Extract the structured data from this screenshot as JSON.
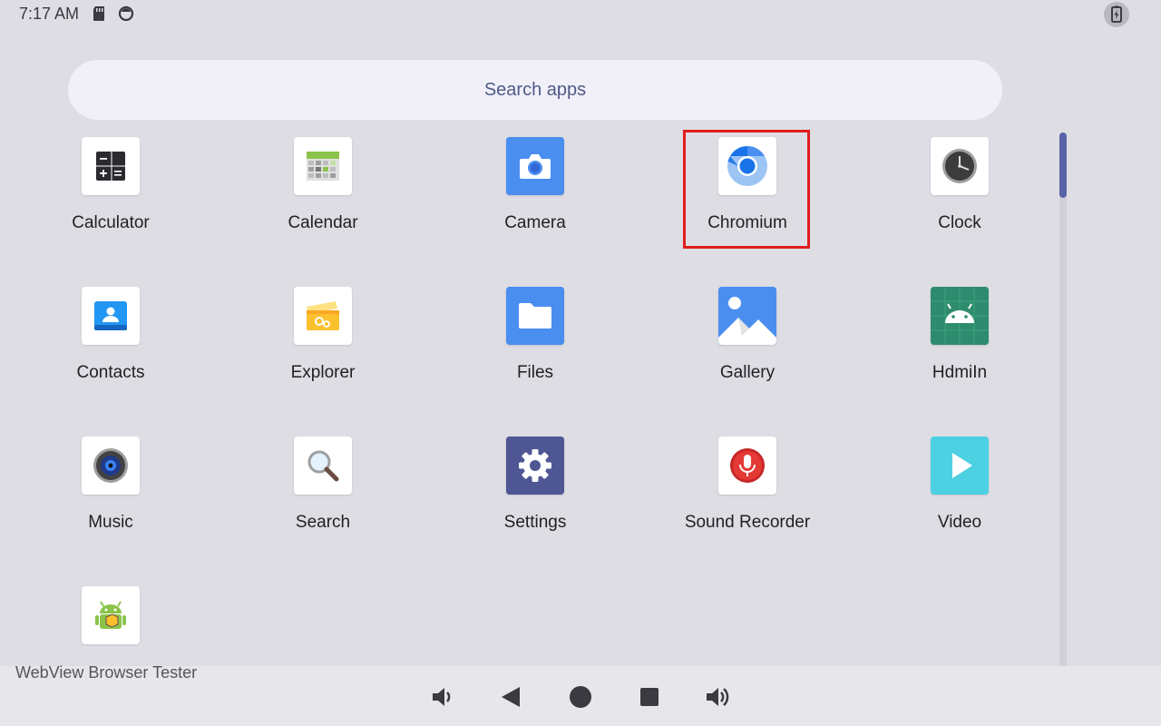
{
  "status_bar": {
    "time": "7:17 AM",
    "icons": [
      "sd-card-icon",
      "sync-icon",
      "battery-icon"
    ]
  },
  "search": {
    "placeholder": "Search apps"
  },
  "apps": [
    {
      "label": "Calculator",
      "icon": "calculator-icon"
    },
    {
      "label": "Calendar",
      "icon": "calendar-icon"
    },
    {
      "label": "Camera",
      "icon": "camera-icon"
    },
    {
      "label": "Chromium",
      "icon": "chromium-icon",
      "highlighted": true
    },
    {
      "label": "Clock",
      "icon": "clock-icon"
    },
    {
      "label": "Contacts",
      "icon": "contacts-icon"
    },
    {
      "label": "Explorer",
      "icon": "explorer-icon"
    },
    {
      "label": "Files",
      "icon": "files-icon"
    },
    {
      "label": "Gallery",
      "icon": "gallery-icon"
    },
    {
      "label": "HdmiIn",
      "icon": "android-icon"
    },
    {
      "label": "Music",
      "icon": "music-icon"
    },
    {
      "label": "Search",
      "icon": "search-icon"
    },
    {
      "label": "Settings",
      "icon": "settings-icon"
    },
    {
      "label": "Sound Recorder",
      "icon": "sound-recorder-icon"
    },
    {
      "label": "Video",
      "icon": "video-icon"
    },
    {
      "label": "WebView Browser Tester",
      "icon": "webview-tester-icon"
    }
  ],
  "nav_bar": {
    "buttons": [
      "volume-down-icon",
      "back-icon",
      "home-icon",
      "recents-icon",
      "volume-up-icon"
    ]
  },
  "colors": {
    "background": "#dedde4",
    "search_bar": "#f1f0f9",
    "highlight": "#e11d1d",
    "scroll_thumb": "#5962a8"
  }
}
